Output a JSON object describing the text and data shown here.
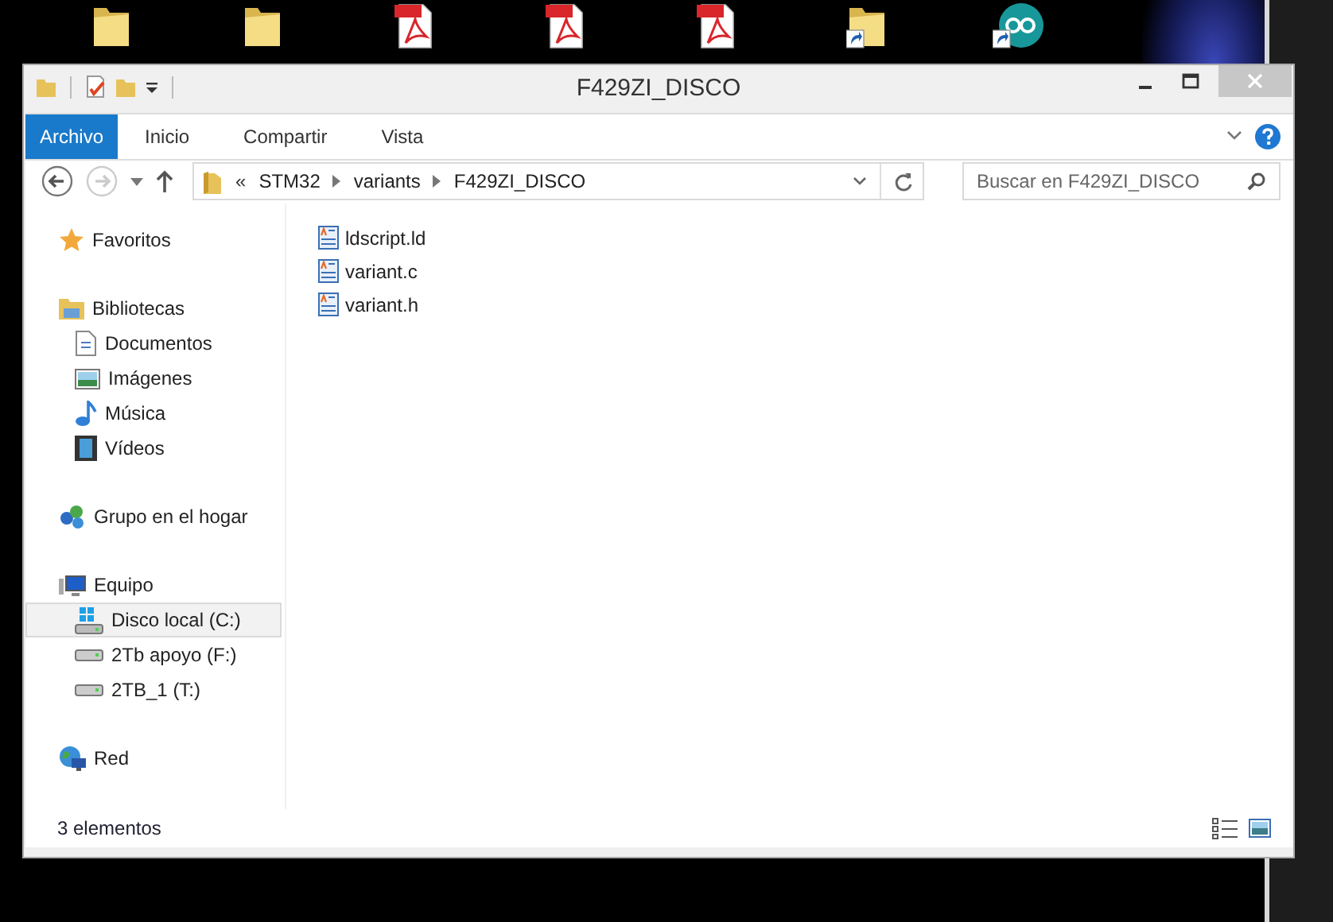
{
  "desktop_icons": [
    {
      "kind": "folder"
    },
    {
      "kind": "folder"
    },
    {
      "kind": "pdf"
    },
    {
      "kind": "pdf"
    },
    {
      "kind": "pdf"
    },
    {
      "kind": "folder_shortcut"
    },
    {
      "kind": "app_shortcut"
    }
  ],
  "window": {
    "title": "F429ZI_DISCO"
  },
  "ribbon_tabs": [
    {
      "label": "Archivo",
      "selected": true
    },
    {
      "label": "Inicio",
      "selected": false
    },
    {
      "label": "Compartir",
      "selected": false
    },
    {
      "label": "Vista",
      "selected": false
    }
  ],
  "address_bar": {
    "overflow": "«",
    "crumbs": [
      "STM32",
      "variants",
      "F429ZI_DISCO"
    ]
  },
  "search": {
    "placeholder": "Buscar en F429ZI_DISCO"
  },
  "sidebar": {
    "groups": [
      {
        "label": "Favoritos",
        "kind": "favorites",
        "selected": false
      },
      {
        "label": "Bibliotecas",
        "kind": "libraries",
        "selected": false,
        "children": [
          {
            "label": "Documentos",
            "kind": "documents",
            "selected": false
          },
          {
            "label": "Imágenes",
            "kind": "pictures",
            "selected": false
          },
          {
            "label": "Música",
            "kind": "music",
            "selected": false
          },
          {
            "label": "Vídeos",
            "kind": "videos",
            "selected": false
          }
        ]
      },
      {
        "label": "Grupo en el hogar",
        "kind": "homegroup",
        "selected": false
      },
      {
        "label": "Equipo",
        "kind": "computer",
        "selected": false,
        "children": [
          {
            "label": "Disco local (C:)",
            "kind": "system_drive",
            "selected": true
          },
          {
            "label": "2Tb apoyo (F:)",
            "kind": "drive",
            "selected": false
          },
          {
            "label": "2TB_1 (T:)",
            "kind": "drive",
            "selected": false
          }
        ]
      },
      {
        "label": "Red",
        "kind": "network",
        "selected": false
      }
    ]
  },
  "files": [
    {
      "name": "ldscript.ld"
    },
    {
      "name": "variant.c"
    },
    {
      "name": "variant.h"
    }
  ],
  "status_bar": {
    "item_count": "3 elementos"
  }
}
